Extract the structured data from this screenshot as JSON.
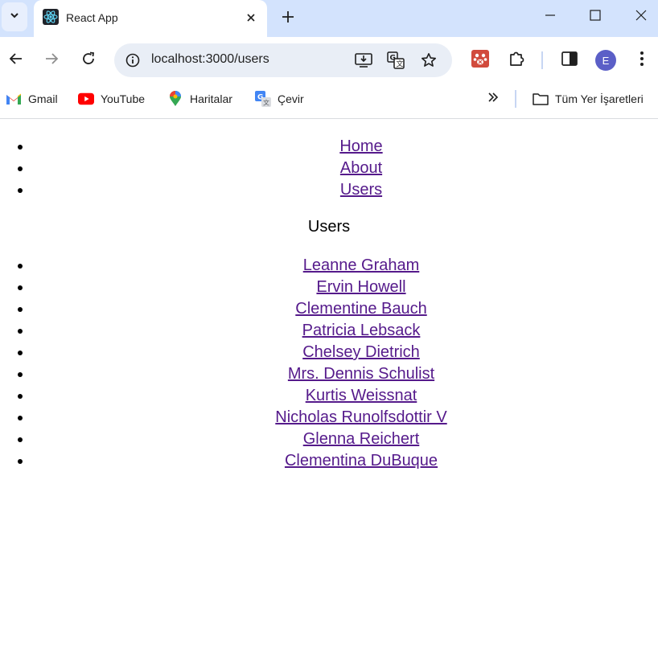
{
  "browser": {
    "tab": {
      "title": "React App",
      "favicon": "react-logo-icon"
    },
    "address": {
      "url": "localhost:3000/users"
    },
    "profile_initial": "E",
    "colors": {
      "tabstrip": "#d3e3fd",
      "omnibox": "#e9eef6",
      "avatar": "#5b5fc7",
      "link_visited": "#551a8b"
    }
  },
  "bookmarks": {
    "items": [
      {
        "label": "Gmail",
        "icon": "gmail-icon"
      },
      {
        "label": "YouTube",
        "icon": "youtube-icon"
      },
      {
        "label": "Haritalar",
        "icon": "maps-pin-icon"
      },
      {
        "label": "Çevir",
        "icon": "translate-icon"
      }
    ],
    "all_bookmarks": "Tüm Yer İşaretleri"
  },
  "page": {
    "nav": [
      "Home",
      "About",
      "Users"
    ],
    "heading": "Users",
    "users": [
      "Leanne Graham",
      "Ervin Howell",
      "Clementine Bauch",
      "Patricia Lebsack",
      "Chelsey Dietrich",
      "Mrs. Dennis Schulist",
      "Kurtis Weissnat",
      "Nicholas Runolfsdottir V",
      "Glenna Reichert",
      "Clementina DuBuque"
    ]
  }
}
